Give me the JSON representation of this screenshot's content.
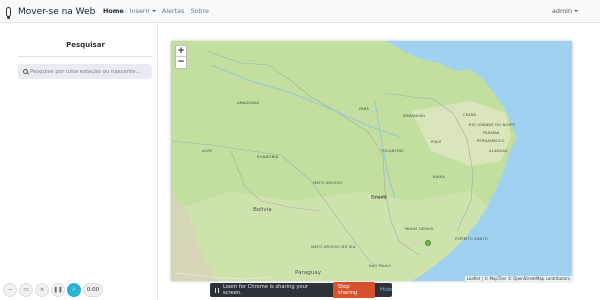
{
  "navbar": {
    "brand": "Mover-se na Web",
    "items": [
      "Home",
      "Inserir",
      "Alertas",
      "Sobre"
    ],
    "user": "admin"
  },
  "sidebar": {
    "title": "Pesquisar",
    "search_placeholder": "Pesquise por uma estação ou nascente..."
  },
  "map": {
    "zoom_in": "+",
    "zoom_out": "−",
    "attribution": "Leaflet | © MapTiler © OpenStreetMap contributors",
    "labels": {
      "amazonas": "AMAZONAS",
      "para": "PARÁ",
      "maranhao": "MARANHÃO",
      "piaui": "PIAUÍ",
      "ceara": "CEARÁ",
      "rio_grande_do_norte": "RIO GRANDE DO NORTE",
      "paraiba": "PARAÍBA",
      "pernambuco": "PERNAMBUCO",
      "alagoas": "ALAGOAS",
      "acre": "ACRE",
      "rondonia": "RONDÔNIA",
      "tocantins": "TOCANTINS",
      "bahia": "BAHIA",
      "mato_grosso": "MATO GROSSO",
      "goias": "GOIÁS",
      "minas_gerais": "MINAS GERAIS",
      "mato_grosso_do_sul": "MATO GROSSO DO SUL",
      "sao_paulo": "SÃO PAULO",
      "espirito_santo": "ESPÍRITO SANTO",
      "brasil": "Brasil",
      "bolivia": "Bolivia",
      "paraguay": "Paraguay"
    },
    "colors": {
      "land": "#c2dfa0",
      "land_dry": "#dfe6c0",
      "water": "#9fd1f0",
      "pin": "#74b84a"
    }
  },
  "recorder": {
    "time": "0:00"
  },
  "share_bar": {
    "message": "Loom for Chrome is sharing your screen.",
    "stop_label": "Stop sharing",
    "hide_label": "Hide"
  }
}
